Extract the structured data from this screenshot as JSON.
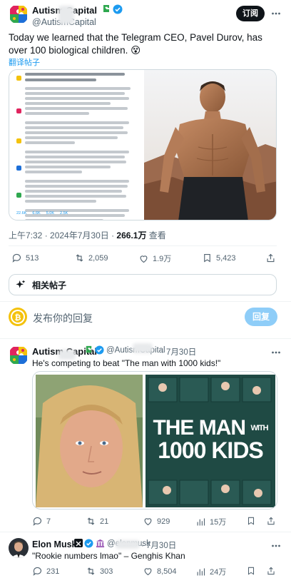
{
  "main_tweet": {
    "author_name": "Autism Capital",
    "author_handle": "@AutismCapital",
    "subscribe_label": "订阅",
    "text": "Today we learned that the Telegram CEO, Pavel Durov, has over 100 biological children. 😵",
    "translate_label": "翻译帖子",
    "timestamp": "上午7:32 · 2024年7月30日",
    "views_count": "266.1万",
    "views_label": "查看",
    "reply_count": "513",
    "retweet_count": "2,059",
    "like_count": "1.9万",
    "bookmark_count": "5,423",
    "note_stats": [
      "22.6K",
      "6.6K",
      "5.0K",
      "2.5K"
    ]
  },
  "related_posts_label": "相关帖子",
  "compose": {
    "placeholder": "发布你的回复",
    "reply_button": "回复"
  },
  "reply_1": {
    "author_name": "Autism Capital",
    "author_handle": "@AutismCapital",
    "date": "· 7月30日",
    "text": "He's competing to beat \"The man with 1000 kids!\"",
    "poster_title_line1": "THE MAN",
    "poster_title_line2": "WITH",
    "poster_title_line3": "1000 KIDS",
    "reply_count": "7",
    "retweet_count": "21",
    "like_count": "929",
    "views_count": "15万"
  },
  "reply_2": {
    "author_name": "Elon Musk",
    "author_handle": "@elonmusk",
    "date": "· 7月30日",
    "text": "\"Rookie numbers lmao\" – Genghis Khan",
    "reply_count": "231",
    "retweet_count": "303",
    "like_count": "8,504",
    "views_count": "24万"
  },
  "colors": {
    "accent": "#1d9bf0",
    "verified_gold": "#e2b719",
    "puzzle_red": "#e0245e",
    "puzzle_yellow": "#f4c20d",
    "puzzle_green": "#2fa84f",
    "puzzle_blue": "#1d6fd8"
  }
}
